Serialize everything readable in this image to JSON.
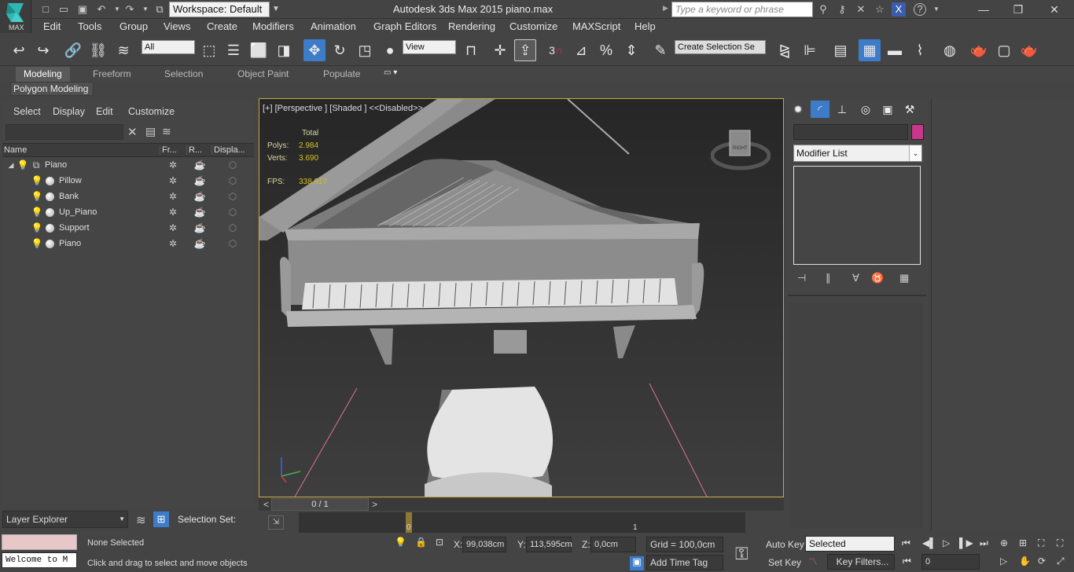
{
  "titlebar": {
    "app_logo": "MAX",
    "workspace": "Workspace: Default",
    "title": "Autodesk 3ds Max  2015      piano.max",
    "search_placeholder": "Type a keyword or phrase"
  },
  "menu": [
    "Edit",
    "Tools",
    "Group",
    "Views",
    "Create",
    "Modifiers",
    "Animation",
    "Graph Editors",
    "Rendering",
    "Customize",
    "MAXScript",
    "Help"
  ],
  "toolbar": {
    "filter_select": "All",
    "ref_coord": "View",
    "snap_label": "3",
    "named_sel": "Create Selection Se"
  },
  "ribbon": {
    "tabs": [
      "Modeling",
      "Freeform",
      "Selection",
      "Object Paint",
      "Populate"
    ],
    "active": "Modeling",
    "panel_label": "Polygon Modeling"
  },
  "explorer": {
    "menus": [
      "Select",
      "Display",
      "Edit",
      "Customize"
    ],
    "columns": [
      "Name",
      "Fr...",
      "R...",
      "Displa..."
    ],
    "rows": [
      {
        "name": "Piano",
        "level": 0
      },
      {
        "name": "Pillow",
        "level": 1
      },
      {
        "name": "Bank",
        "level": 1
      },
      {
        "name": "Up_Piano",
        "level": 1
      },
      {
        "name": "Support",
        "level": 1
      },
      {
        "name": "Piano",
        "level": 1
      }
    ],
    "layer_dropdown": "Layer Explorer",
    "selection_set": "Selection Set:"
  },
  "viewport": {
    "label": "[+] [Perspective ] [Shaded ]  <<Disabled>>",
    "stats": {
      "header": "Total",
      "polys_label": "Polys:",
      "polys": "2.984",
      "verts_label": "Verts:",
      "verts": "3.690",
      "fps_label": "FPS:",
      "fps": "338,817"
    },
    "viewcube_label": "RIGHT"
  },
  "timeline": {
    "frame": "0 / 1",
    "prev": "<",
    "next": ">",
    "marker0": "0",
    "marker1": "1"
  },
  "command_panel": {
    "modifier_list": "Modifier List",
    "object_color": "#c8378a"
  },
  "status": {
    "maxscript": "Welcome to M",
    "selected": "None Selected",
    "prompt": "Click and drag to select and move objects",
    "x_label": "X:",
    "x_val": "99,038cm",
    "y_label": "Y:",
    "y_val": "113,595cm",
    "z_label": "Z:",
    "z_val": "0,0cm",
    "grid": "Grid = 100,0cm",
    "add_time_tag": "Add Time Tag",
    "auto_key": "Auto Key",
    "set_key": "Set Key",
    "key_mode": "Selected",
    "key_filters": "Key Filters...",
    "current_frame": "0"
  }
}
